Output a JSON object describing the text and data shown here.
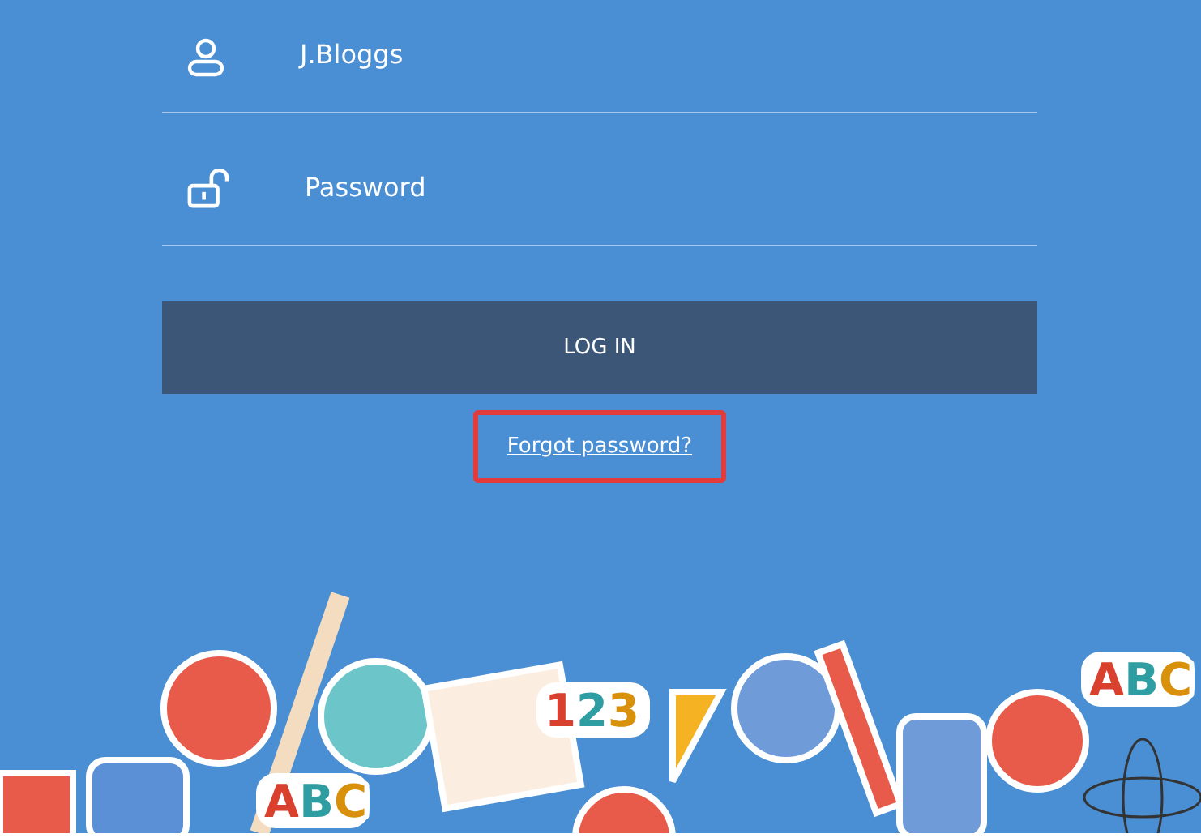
{
  "username_field": {
    "value": "J.Bloggs"
  },
  "password_field": {
    "placeholder": "Password"
  },
  "login_button": {
    "label": "LOG IN"
  },
  "forgot_link": {
    "text": "Forgot password?",
    "highlighted": true
  },
  "illustration": {
    "sticker_texts": [
      {
        "text": "ABC",
        "kind": "abc"
      },
      {
        "text": "123",
        "kind": "numbers"
      },
      {
        "text": "ABC",
        "kind": "abc-right"
      }
    ]
  }
}
